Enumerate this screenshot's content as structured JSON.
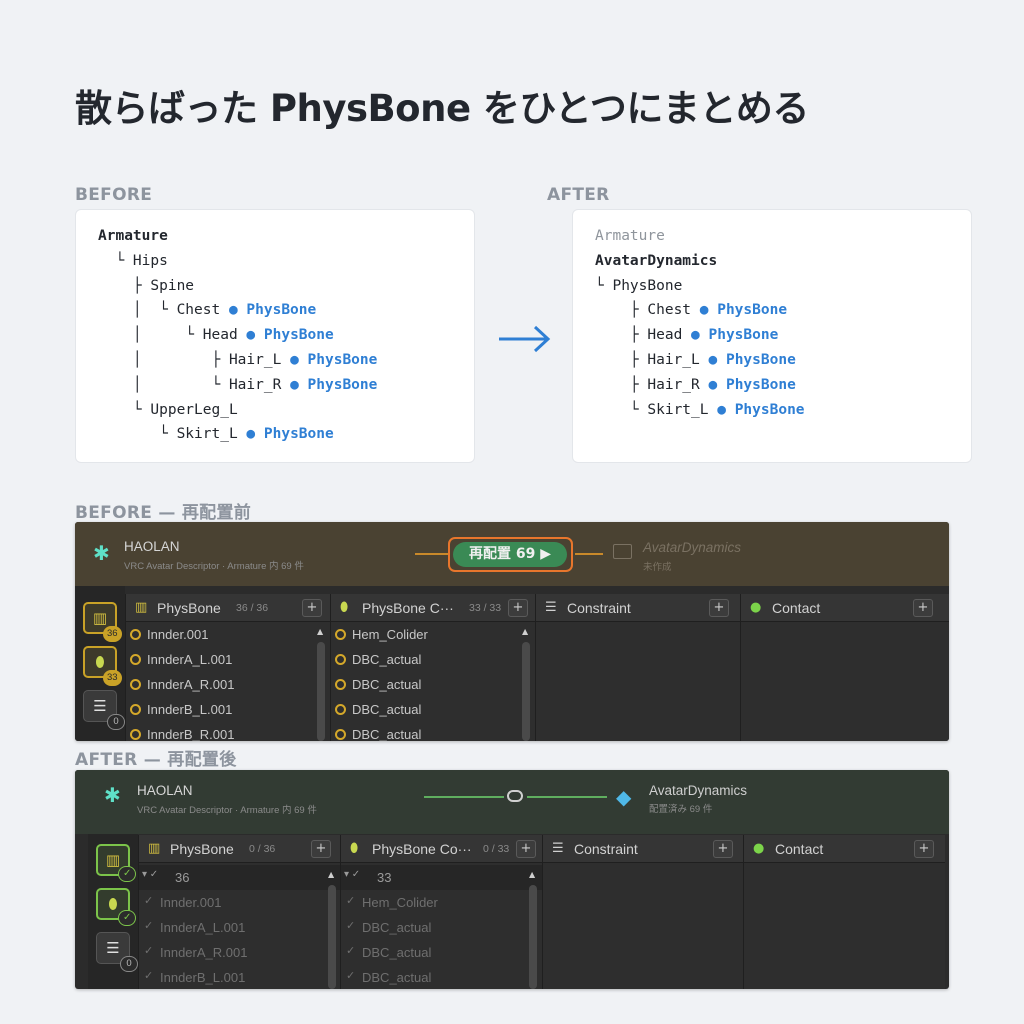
{
  "title": "散らばった PhysBone をひとつにまとめる",
  "labels": {
    "before": "BEFORE",
    "after": "AFTER",
    "before_panel": "BEFORE — 再配置前",
    "after_panel": "AFTER — 再配置後"
  },
  "before_tree": {
    "root": "Armature",
    "hips": "└ Hips",
    "spine": "├ Spine",
    "chest_prefix": "│  └ Chest ",
    "head_prefix": "│     └ Head ",
    "hair_l_prefix": "│        ├ Hair_L ",
    "hair_r_prefix": "│        └ Hair_R ",
    "upperleg": "└ UpperLeg_L",
    "skirt_prefix": "└ Skirt_L ",
    "bullet": "● PhysBone"
  },
  "after_tree": {
    "root": "Armature",
    "dynamics": "AvatarDynamics",
    "physbone": "└ PhysBone",
    "chest_prefix": "├ Chest ",
    "head_prefix": "├ Head ",
    "hair_l_prefix": "├ Hair_L ",
    "hair_r_prefix": "├ Hair_R ",
    "skirt_prefix": "└ Skirt_L ",
    "bullet": "● PhysBone"
  },
  "before_panel": {
    "avatar_name": "HAOLAN",
    "avatar_sub": "VRC Avatar Descriptor · Armature 内 69 件",
    "relocate_button": "再配置 69 ▶",
    "dest_name": "AvatarDynamics",
    "dest_sub": "未作成",
    "sidebar": {
      "physbone_badge": "36",
      "collider_badge": "33",
      "constraint_badge": "0"
    },
    "columns": [
      {
        "label": "PhysBone",
        "count": "36 / 36",
        "items": [
          "Innder.001",
          "InnderA_L.001",
          "InnderA_R.001",
          "InnderB_L.001",
          "InnderB_R.001"
        ]
      },
      {
        "label": "PhysBone C···",
        "count": "33 / 33",
        "items": [
          "Hem_Colider",
          "DBC_actual",
          "DBC_actual",
          "DBC_actual",
          "DBC_actual"
        ]
      },
      {
        "label": "Constraint",
        "count": "",
        "items": []
      },
      {
        "label": "Contact",
        "count": "",
        "items": []
      }
    ]
  },
  "after_panel": {
    "avatar_name": "HAOLAN",
    "avatar_sub": "VRC Avatar Descriptor · Armature 内 69 件",
    "dest_name": "AvatarDynamics",
    "dest_sub": "配置済み 69 件",
    "sidebar": {
      "constraint_badge": "0"
    },
    "columns": [
      {
        "label": "PhysBone",
        "count": "0 / 36",
        "group": "36",
        "items": [
          "Innder.001",
          "InnderA_L.001",
          "InnderA_R.001",
          "InnderB_L.001"
        ]
      },
      {
        "label": "PhysBone Co···",
        "count": "0 / 33",
        "group": "33",
        "items": [
          "Hem_Colider",
          "DBC_actual",
          "DBC_actual",
          "DBC_actual"
        ]
      },
      {
        "label": "Constraint",
        "count": "",
        "items": []
      },
      {
        "label": "Contact",
        "count": "",
        "items": []
      }
    ]
  },
  "colors": {
    "physbone_blue": "#2f7fd4",
    "accent_gold": "#c9a227",
    "accent_green": "#7cc44a",
    "orange_highlight": "#e8762c",
    "button_green": "#3a8a55"
  }
}
